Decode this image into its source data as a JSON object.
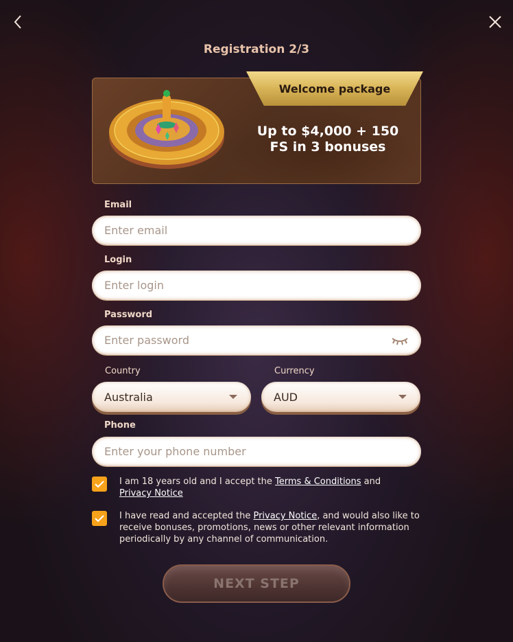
{
  "header": {
    "title": "Registration 2/3",
    "back_icon": "chevron-left-icon",
    "close_icon": "close-icon"
  },
  "banner": {
    "ribbon_label": "Welcome package",
    "offer_line1": "Up to $4,000 + 150",
    "offer_line2": "FS in 3 bonuses",
    "image": "roulette-wheel"
  },
  "form": {
    "email": {
      "label": "Email",
      "placeholder": "Enter email",
      "value": ""
    },
    "login": {
      "label": "Login",
      "placeholder": "Enter login",
      "value": ""
    },
    "password": {
      "label": "Password",
      "placeholder": "Enter password",
      "value": "",
      "toggle_icon": "eye-closed-icon"
    },
    "country": {
      "label": "Country",
      "value": "Australia"
    },
    "currency": {
      "label": "Currency",
      "value": "AUD"
    },
    "phone": {
      "label": "Phone",
      "placeholder": "Enter your phone number",
      "value": ""
    }
  },
  "consents": [
    {
      "checked": true,
      "text_before": "I am 18 years old and I accept the ",
      "link1": "Terms & Conditions",
      "text_middle": " and ",
      "link2": "Privacy Notice",
      "text_after": ""
    },
    {
      "checked": true,
      "text_before": "I have read and accepted the ",
      "link1": "Privacy Notice",
      "text_after": ", and would also like to receive bonuses, promotions, news or other relevant information periodically by any channel of communication."
    }
  ],
  "actions": {
    "next_label": "NEXT STEP"
  },
  "colors": {
    "accent_checkbox": "#f7a21b",
    "title": "#e8c3aa",
    "ribbon_gold": "#d8b457"
  }
}
